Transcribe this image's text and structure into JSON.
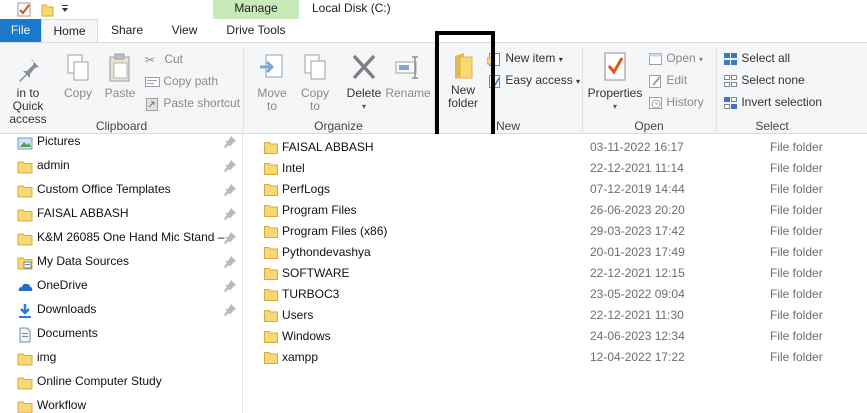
{
  "window": {
    "title": "Local Disk (C:)"
  },
  "tabs": {
    "file": "File",
    "home": "Home",
    "share": "Share",
    "view": "View",
    "contextual_group": "Manage",
    "drive_tools": "Drive Tools"
  },
  "ribbon": {
    "clipboard": {
      "group_label": "Clipboard",
      "pin_line1": "in to Quick",
      "pin_line2": "access",
      "copy": "Copy",
      "paste": "Paste",
      "cut": "Cut",
      "copy_path": "Copy path",
      "paste_shortcut": "Paste shortcut"
    },
    "organize": {
      "group_label": "Organize",
      "move_line1": "Move",
      "move_line2": "to",
      "copy_line1": "Copy",
      "copy_line2": "to",
      "delete": "Delete",
      "rename": "Rename"
    },
    "new": {
      "group_label": "New",
      "new_folder_line1": "New",
      "new_folder_line2": "folder",
      "new_item": "New item",
      "easy_access": "Easy access"
    },
    "open": {
      "group_label": "Open",
      "properties": "Properties",
      "open": "Open",
      "edit": "Edit",
      "history": "History"
    },
    "select": {
      "group_label": "Select",
      "select_all": "Select all",
      "select_none": "Select none",
      "invert_selection": "Invert selection"
    }
  },
  "nav": [
    {
      "label": "Pictures",
      "icon": "pictures-icon",
      "pinned": true
    },
    {
      "label": "admin",
      "icon": "folder-icon",
      "pinned": true
    },
    {
      "label": "Custom Office Templates",
      "icon": "folder-icon",
      "pinned": true
    },
    {
      "label": "FAISAL ABBASH",
      "icon": "folder-icon",
      "pinned": true
    },
    {
      "label": "K&M 26085 One Hand Mic Stand –",
      "icon": "folder-icon",
      "pinned": true
    },
    {
      "label": "My Data Sources",
      "icon": "data-sources-icon",
      "pinned": true
    },
    {
      "label": "OneDrive",
      "icon": "onedrive-icon",
      "pinned": true
    },
    {
      "label": "Downloads",
      "icon": "downloads-icon",
      "pinned": true
    },
    {
      "label": "Documents",
      "icon": "documents-icon",
      "pinned": false
    },
    {
      "label": "img",
      "icon": "folder-icon",
      "pinned": false
    },
    {
      "label": "Online Computer Study",
      "icon": "folder-icon",
      "pinned": false
    },
    {
      "label": "Workflow",
      "icon": "folder-icon",
      "pinned": false
    }
  ],
  "files": [
    {
      "name": "FAISAL ABBASH",
      "date": "03-11-2022 16:17",
      "type": "File folder"
    },
    {
      "name": "Intel",
      "date": "22-12-2021 11:14",
      "type": "File folder"
    },
    {
      "name": "PerfLogs",
      "date": "07-12-2019 14:44",
      "type": "File folder"
    },
    {
      "name": "Program Files",
      "date": "26-06-2023 20:20",
      "type": "File folder"
    },
    {
      "name": "Program Files (x86)",
      "date": "29-03-2023 17:42",
      "type": "File folder"
    },
    {
      "name": "Pythondevashya",
      "date": "20-01-2023 17:49",
      "type": "File folder"
    },
    {
      "name": "SOFTWARE",
      "date": "22-12-2021 12:15",
      "type": "File folder"
    },
    {
      "name": "TURBOC3",
      "date": "23-05-2022 09:04",
      "type": "File folder"
    },
    {
      "name": "Users",
      "date": "22-12-2021 11:30",
      "type": "File folder"
    },
    {
      "name": "Windows",
      "date": "24-06-2023 12:34",
      "type": "File folder"
    },
    {
      "name": "xampp",
      "date": "12-04-2022 17:22",
      "type": "File folder"
    }
  ],
  "colors": {
    "file_tab": "#1979ca",
    "manage_band": "#c9ebb9",
    "folder_yellow": "#f8d775",
    "highlight_border": "#000000"
  }
}
